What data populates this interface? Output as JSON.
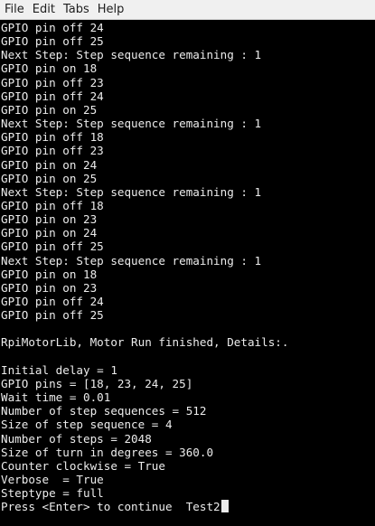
{
  "menu": {
    "file": "File",
    "edit": "Edit",
    "tabs": "Tabs",
    "help": "Help"
  },
  "terminal": {
    "lines": [
      "GPIO pin off 24",
      "GPIO pin off 25",
      "Next Step: Step sequence remaining : 1",
      "GPIO pin on 18",
      "GPIO pin off 23",
      "GPIO pin off 24",
      "GPIO pin on 25",
      "Next Step: Step sequence remaining : 1",
      "GPIO pin off 18",
      "GPIO pin off 23",
      "GPIO pin on 24",
      "GPIO pin on 25",
      "Next Step: Step sequence remaining : 1",
      "GPIO pin off 18",
      "GPIO pin on 23",
      "GPIO pin on 24",
      "GPIO pin off 25",
      "Next Step: Step sequence remaining : 1",
      "GPIO pin on 18",
      "GPIO pin on 23",
      "GPIO pin off 24",
      "GPIO pin off 25",
      "",
      "RpiMotorLib, Motor Run finished, Details:.",
      "",
      "Initial delay = 1",
      "GPIO pins = [18, 23, 24, 25]",
      "Wait time = 0.01",
      "Number of step sequences = 512",
      "Size of step sequence = 4",
      "Number of steps = 2048",
      "Size of turn in degrees = 360.0",
      "Counter clockwise = True",
      "Verbose  = True",
      "Steptype = full"
    ],
    "prompt": "Press <Enter> to continue  Test2"
  }
}
